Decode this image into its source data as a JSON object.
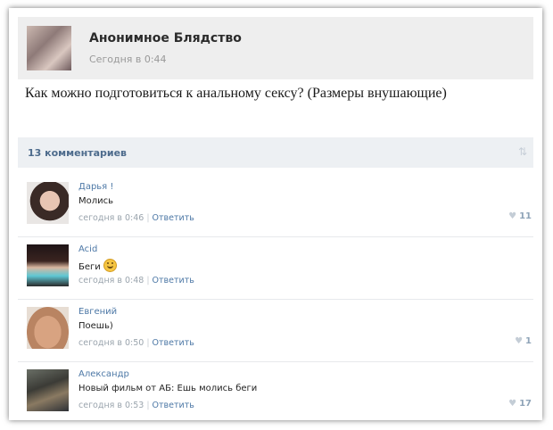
{
  "post": {
    "author": "Анонимное Блядство",
    "time": "Сегодня в 0:44",
    "text": "Как можно подготовиться к анальному сексу? (Размеры внушающие)"
  },
  "comments_bar": {
    "count_label": "13 комментариев",
    "sort_icon": "sort-arrows-icon"
  },
  "comments": [
    {
      "name": "Дарья !",
      "text": "Молись",
      "time": "сегодня в 0:46",
      "reply": "Ответить",
      "likes": "11"
    },
    {
      "name": "Acid",
      "text": "Беги",
      "time": "сегодня в 0:48",
      "reply": "Ответить",
      "likes": "",
      "emoji": "smile-icon"
    },
    {
      "name": "Евгений",
      "text": "Поешь)",
      "time": "сегодня в 0:50",
      "reply": "Ответить",
      "likes": "1"
    },
    {
      "name": "Александр",
      "text": "Новый фильм от АБ: Ешь молись беги",
      "time": "сегодня в 0:53",
      "reply": "Ответить",
      "likes": "17"
    }
  ],
  "colors": {
    "header_bg": "#eeeeee",
    "bar_bg": "#edf0f3",
    "link": "#4d78a6",
    "meta": "#9aa4ad"
  }
}
